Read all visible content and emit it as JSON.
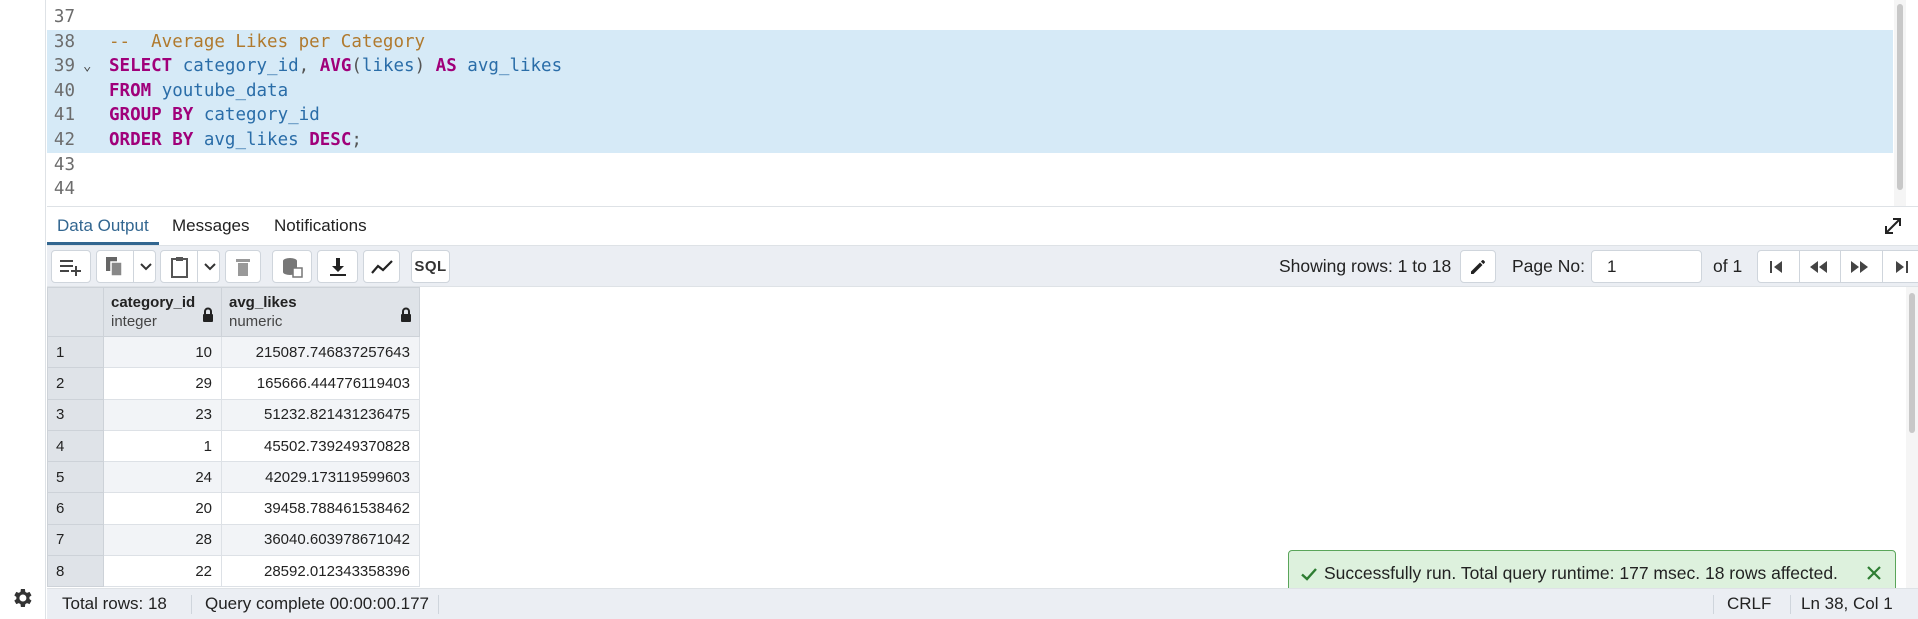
{
  "editor": {
    "lines": [
      {
        "num": "37",
        "sel": false,
        "fold": "",
        "tokens": []
      },
      {
        "num": "38",
        "sel": true,
        "fold": "",
        "tokens": [
          {
            "t": "--  Average Likes per Category",
            "c": "cmt"
          }
        ]
      },
      {
        "num": "39",
        "sel": true,
        "fold": "⌄",
        "tokens": [
          {
            "t": "SELECT",
            "c": "kw"
          },
          {
            "t": " ",
            "c": ""
          },
          {
            "t": "category_id",
            "c": "ident"
          },
          {
            "t": ", ",
            "c": "punc"
          },
          {
            "t": "AVG",
            "c": "kw"
          },
          {
            "t": "(",
            "c": "punc"
          },
          {
            "t": "likes",
            "c": "ident"
          },
          {
            "t": ") ",
            "c": "punc"
          },
          {
            "t": "AS",
            "c": "kw"
          },
          {
            "t": " ",
            "c": ""
          },
          {
            "t": "avg_likes",
            "c": "ident"
          }
        ]
      },
      {
        "num": "40",
        "sel": true,
        "fold": "",
        "tokens": [
          {
            "t": "FROM",
            "c": "kw"
          },
          {
            "t": " ",
            "c": ""
          },
          {
            "t": "youtube_data",
            "c": "ident"
          }
        ]
      },
      {
        "num": "41",
        "sel": true,
        "fold": "",
        "tokens": [
          {
            "t": "GROUP BY",
            "c": "kw"
          },
          {
            "t": " ",
            "c": ""
          },
          {
            "t": "category_id",
            "c": "ident"
          }
        ]
      },
      {
        "num": "42",
        "sel": true,
        "fold": "",
        "tokens": [
          {
            "t": "ORDER BY",
            "c": "kw"
          },
          {
            "t": " ",
            "c": ""
          },
          {
            "t": "avg_likes",
            "c": "ident"
          },
          {
            "t": " ",
            "c": ""
          },
          {
            "t": "DESC",
            "c": "kw"
          },
          {
            "t": ";",
            "c": "punc"
          }
        ]
      },
      {
        "num": "43",
        "sel": false,
        "fold": "",
        "tokens": []
      },
      {
        "num": "44",
        "sel": false,
        "fold": "",
        "tokens": []
      }
    ]
  },
  "tabs": {
    "data_output": "Data Output",
    "messages": "Messages",
    "notifications": "Notifications"
  },
  "toolbar": {
    "sql_label": "SQL",
    "showing_rows": "Showing rows: 1 to 18",
    "page_no_label": "Page No:",
    "page_no_value": "1",
    "of_label": "of 1"
  },
  "grid": {
    "columns": [
      {
        "name": "category_id",
        "type": "integer"
      },
      {
        "name": "avg_likes",
        "type": "numeric"
      }
    ],
    "rows": [
      {
        "n": "1",
        "category_id": "10",
        "avg_likes": "215087.746837257643"
      },
      {
        "n": "2",
        "category_id": "29",
        "avg_likes": "165666.444776119403"
      },
      {
        "n": "3",
        "category_id": "23",
        "avg_likes": "51232.821431236475"
      },
      {
        "n": "4",
        "category_id": "1",
        "avg_likes": "45502.739249370828"
      },
      {
        "n": "5",
        "category_id": "24",
        "avg_likes": "42029.173119599603"
      },
      {
        "n": "6",
        "category_id": "20",
        "avg_likes": "39458.788461538462"
      },
      {
        "n": "7",
        "category_id": "28",
        "avg_likes": "36040.603978671042"
      },
      {
        "n": "8",
        "category_id": "22",
        "avg_likes": "28592.012343358396"
      }
    ]
  },
  "toast": {
    "message": "Successfully run. Total query runtime: 177 msec. 18 rows affected."
  },
  "status": {
    "total_rows": "Total rows: 18",
    "query_complete": "Query complete 00:00:00.177",
    "line_ending": "CRLF",
    "cursor": "Ln 38, Col 1"
  },
  "colors": {
    "accent": "#326690",
    "keyword": "#a0007a",
    "identifier": "#2a6da8",
    "comment": "#b07a2e",
    "selection": "#d6eaf7",
    "toast_bg": "#ddf1dd",
    "toast_border": "#5aa55a"
  },
  "icons": [
    "gear-icon",
    "expand-icon",
    "add-row-icon",
    "copy-icon",
    "chevron-down-icon",
    "paste-icon",
    "delete-icon",
    "save-data-icon",
    "download-icon",
    "graph-icon",
    "edit-icon",
    "first-page-icon",
    "prev-page-icon",
    "next-page-icon",
    "last-page-icon",
    "lock-icon",
    "check-icon",
    "close-icon"
  ]
}
